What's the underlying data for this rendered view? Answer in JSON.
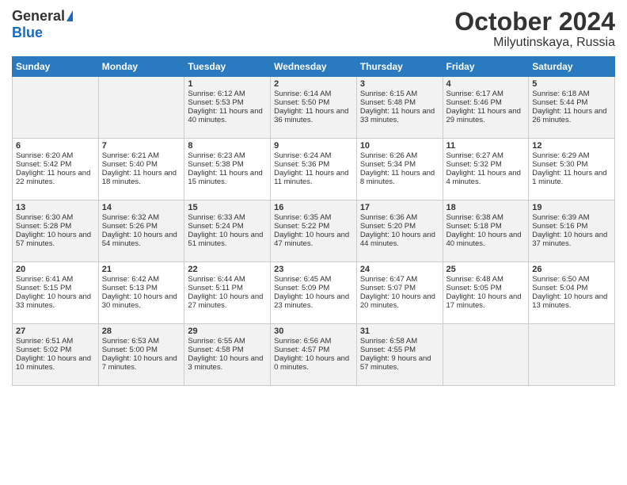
{
  "logo": {
    "general": "General",
    "blue": "Blue"
  },
  "title": "October 2024",
  "location": "Milyutinskaya, Russia",
  "weekdays": [
    "Sunday",
    "Monday",
    "Tuesday",
    "Wednesday",
    "Thursday",
    "Friday",
    "Saturday"
  ],
  "weeks": [
    [
      {
        "day": "",
        "sunrise": "",
        "sunset": "",
        "daylight": ""
      },
      {
        "day": "",
        "sunrise": "",
        "sunset": "",
        "daylight": ""
      },
      {
        "day": "1",
        "sunrise": "Sunrise: 6:12 AM",
        "sunset": "Sunset: 5:53 PM",
        "daylight": "Daylight: 11 hours and 40 minutes."
      },
      {
        "day": "2",
        "sunrise": "Sunrise: 6:14 AM",
        "sunset": "Sunset: 5:50 PM",
        "daylight": "Daylight: 11 hours and 36 minutes."
      },
      {
        "day": "3",
        "sunrise": "Sunrise: 6:15 AM",
        "sunset": "Sunset: 5:48 PM",
        "daylight": "Daylight: 11 hours and 33 minutes."
      },
      {
        "day": "4",
        "sunrise": "Sunrise: 6:17 AM",
        "sunset": "Sunset: 5:46 PM",
        "daylight": "Daylight: 11 hours and 29 minutes."
      },
      {
        "day": "5",
        "sunrise": "Sunrise: 6:18 AM",
        "sunset": "Sunset: 5:44 PM",
        "daylight": "Daylight: 11 hours and 26 minutes."
      }
    ],
    [
      {
        "day": "6",
        "sunrise": "Sunrise: 6:20 AM",
        "sunset": "Sunset: 5:42 PM",
        "daylight": "Daylight: 11 hours and 22 minutes."
      },
      {
        "day": "7",
        "sunrise": "Sunrise: 6:21 AM",
        "sunset": "Sunset: 5:40 PM",
        "daylight": "Daylight: 11 hours and 18 minutes."
      },
      {
        "day": "8",
        "sunrise": "Sunrise: 6:23 AM",
        "sunset": "Sunset: 5:38 PM",
        "daylight": "Daylight: 11 hours and 15 minutes."
      },
      {
        "day": "9",
        "sunrise": "Sunrise: 6:24 AM",
        "sunset": "Sunset: 5:36 PM",
        "daylight": "Daylight: 11 hours and 11 minutes."
      },
      {
        "day": "10",
        "sunrise": "Sunrise: 6:26 AM",
        "sunset": "Sunset: 5:34 PM",
        "daylight": "Daylight: 11 hours and 8 minutes."
      },
      {
        "day": "11",
        "sunrise": "Sunrise: 6:27 AM",
        "sunset": "Sunset: 5:32 PM",
        "daylight": "Daylight: 11 hours and 4 minutes."
      },
      {
        "day": "12",
        "sunrise": "Sunrise: 6:29 AM",
        "sunset": "Sunset: 5:30 PM",
        "daylight": "Daylight: 11 hours and 1 minute."
      }
    ],
    [
      {
        "day": "13",
        "sunrise": "Sunrise: 6:30 AM",
        "sunset": "Sunset: 5:28 PM",
        "daylight": "Daylight: 10 hours and 57 minutes."
      },
      {
        "day": "14",
        "sunrise": "Sunrise: 6:32 AM",
        "sunset": "Sunset: 5:26 PM",
        "daylight": "Daylight: 10 hours and 54 minutes."
      },
      {
        "day": "15",
        "sunrise": "Sunrise: 6:33 AM",
        "sunset": "Sunset: 5:24 PM",
        "daylight": "Daylight: 10 hours and 51 minutes."
      },
      {
        "day": "16",
        "sunrise": "Sunrise: 6:35 AM",
        "sunset": "Sunset: 5:22 PM",
        "daylight": "Daylight: 10 hours and 47 minutes."
      },
      {
        "day": "17",
        "sunrise": "Sunrise: 6:36 AM",
        "sunset": "Sunset: 5:20 PM",
        "daylight": "Daylight: 10 hours and 44 minutes."
      },
      {
        "day": "18",
        "sunrise": "Sunrise: 6:38 AM",
        "sunset": "Sunset: 5:18 PM",
        "daylight": "Daylight: 10 hours and 40 minutes."
      },
      {
        "day": "19",
        "sunrise": "Sunrise: 6:39 AM",
        "sunset": "Sunset: 5:16 PM",
        "daylight": "Daylight: 10 hours and 37 minutes."
      }
    ],
    [
      {
        "day": "20",
        "sunrise": "Sunrise: 6:41 AM",
        "sunset": "Sunset: 5:15 PM",
        "daylight": "Daylight: 10 hours and 33 minutes."
      },
      {
        "day": "21",
        "sunrise": "Sunrise: 6:42 AM",
        "sunset": "Sunset: 5:13 PM",
        "daylight": "Daylight: 10 hours and 30 minutes."
      },
      {
        "day": "22",
        "sunrise": "Sunrise: 6:44 AM",
        "sunset": "Sunset: 5:11 PM",
        "daylight": "Daylight: 10 hours and 27 minutes."
      },
      {
        "day": "23",
        "sunrise": "Sunrise: 6:45 AM",
        "sunset": "Sunset: 5:09 PM",
        "daylight": "Daylight: 10 hours and 23 minutes."
      },
      {
        "day": "24",
        "sunrise": "Sunrise: 6:47 AM",
        "sunset": "Sunset: 5:07 PM",
        "daylight": "Daylight: 10 hours and 20 minutes."
      },
      {
        "day": "25",
        "sunrise": "Sunrise: 6:48 AM",
        "sunset": "Sunset: 5:05 PM",
        "daylight": "Daylight: 10 hours and 17 minutes."
      },
      {
        "day": "26",
        "sunrise": "Sunrise: 6:50 AM",
        "sunset": "Sunset: 5:04 PM",
        "daylight": "Daylight: 10 hours and 13 minutes."
      }
    ],
    [
      {
        "day": "27",
        "sunrise": "Sunrise: 6:51 AM",
        "sunset": "Sunset: 5:02 PM",
        "daylight": "Daylight: 10 hours and 10 minutes."
      },
      {
        "day": "28",
        "sunrise": "Sunrise: 6:53 AM",
        "sunset": "Sunset: 5:00 PM",
        "daylight": "Daylight: 10 hours and 7 minutes."
      },
      {
        "day": "29",
        "sunrise": "Sunrise: 6:55 AM",
        "sunset": "Sunset: 4:58 PM",
        "daylight": "Daylight: 10 hours and 3 minutes."
      },
      {
        "day": "30",
        "sunrise": "Sunrise: 6:56 AM",
        "sunset": "Sunset: 4:57 PM",
        "daylight": "Daylight: 10 hours and 0 minutes."
      },
      {
        "day": "31",
        "sunrise": "Sunrise: 6:58 AM",
        "sunset": "Sunset: 4:55 PM",
        "daylight": "Daylight: 9 hours and 57 minutes."
      },
      {
        "day": "",
        "sunrise": "",
        "sunset": "",
        "daylight": ""
      },
      {
        "day": "",
        "sunrise": "",
        "sunset": "",
        "daylight": ""
      }
    ]
  ]
}
